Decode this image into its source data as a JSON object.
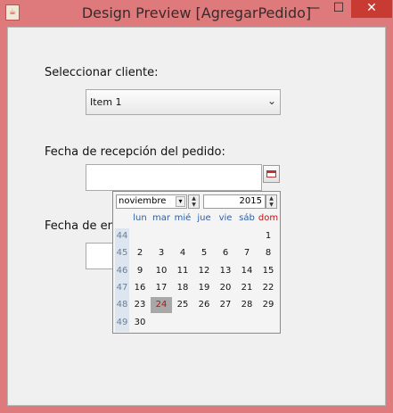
{
  "window": {
    "title": "Design Preview [AgregarPedido]",
    "min": "—",
    "max": "☐",
    "close": "✕",
    "icon": "java-icon"
  },
  "form": {
    "cliente_label": "Seleccionar cliente:",
    "cliente_value": "Item 1",
    "fecha_recepcion_label": "Fecha de recepción del pedido:",
    "fecha_entrega_label": "Fecha de en"
  },
  "calendar": {
    "month": "noviembre",
    "year": "2015",
    "weekdays": [
      "lun",
      "mar",
      "mié",
      "jue",
      "vie",
      "sáb",
      "dom"
    ],
    "weeks": [
      {
        "num": "44",
        "days": [
          "",
          "",
          "",
          "",
          "",
          "",
          "1"
        ]
      },
      {
        "num": "45",
        "days": [
          "2",
          "3",
          "4",
          "5",
          "6",
          "7",
          "8"
        ]
      },
      {
        "num": "46",
        "days": [
          "9",
          "10",
          "11",
          "12",
          "13",
          "14",
          "15"
        ]
      },
      {
        "num": "47",
        "days": [
          "16",
          "17",
          "18",
          "19",
          "20",
          "21",
          "22"
        ]
      },
      {
        "num": "48",
        "days": [
          "23",
          "24",
          "25",
          "26",
          "27",
          "28",
          "29"
        ]
      },
      {
        "num": "49",
        "days": [
          "30",
          "",
          "",
          "",
          "",
          "",
          ""
        ]
      }
    ],
    "selected": "24"
  }
}
